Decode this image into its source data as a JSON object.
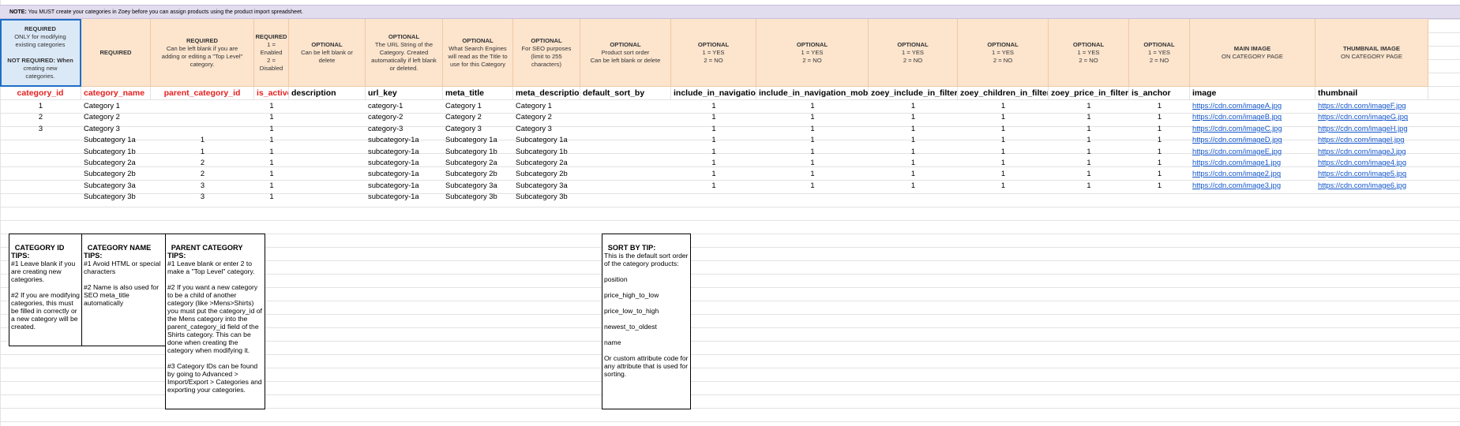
{
  "note": {
    "label": "NOTE:",
    "text": "You MUST create your categories in Zoey before you can assign products using the product import spreadsheet."
  },
  "columns": [
    {
      "key": "category_id",
      "width": 103,
      "name_color": "red",
      "header": [
        "REQUIRED",
        "ONLY for modifying",
        "existing categories",
        "",
        "NOT REQUIRED: When",
        "creating new",
        "categories."
      ],
      "align": "c"
    },
    {
      "key": "category_name",
      "width": 88,
      "name_color": "red",
      "header": [
        "REQUIRED"
      ],
      "align": "l"
    },
    {
      "key": "parent_category_id",
      "width": 131,
      "name_color": "red",
      "header": [
        "REQUIRED",
        "Can be left blank if you are",
        "adding or editing a \"Top Level\"",
        "category."
      ],
      "align": "c"
    },
    {
      "key": "is_active",
      "width": 44,
      "name_color": "red",
      "header": [
        "REQUIRED",
        "1 = Enabled",
        "2 = Disabled"
      ],
      "align": "c"
    },
    {
      "key": "description",
      "width": 97,
      "name_color": "black",
      "header": [
        "OPTIONAL",
        "Can be left blank or",
        "delete"
      ],
      "align": "l"
    },
    {
      "key": "url_key",
      "width": 98,
      "name_color": "black",
      "header": [
        "OPTIONAL",
        "The URL String of the",
        "Category. Created",
        "automatically if left blank",
        "or deleted."
      ],
      "align": "l"
    },
    {
      "key": "meta_title",
      "width": 89,
      "name_color": "black",
      "header": [
        "OPTIONAL",
        "What Search Engines",
        "will read as the Title to",
        "use for this Category"
      ],
      "align": "l"
    },
    {
      "key": "meta_description",
      "width": 85,
      "name_color": "black",
      "header": [
        "OPTIONAL",
        "For SEO purposes",
        "(limit to 255",
        "characters)"
      ],
      "align": "l"
    },
    {
      "key": "default_sort_by",
      "width": 115,
      "name_color": "black",
      "header": [
        "OPTIONAL",
        "Product sort order",
        "Can be left blank or delete"
      ],
      "align": "l"
    },
    {
      "key": "include_in_navigation",
      "width": 108,
      "name_color": "black",
      "header": [
        "OPTIONAL",
        "1 = YES",
        "2 = NO"
      ],
      "align": "c"
    },
    {
      "key": "include_in_navigation_mobile",
      "width": 142,
      "name_color": "black",
      "header": [
        "OPTIONAL",
        "1 = YES",
        "2 = NO"
      ],
      "align": "c"
    },
    {
      "key": "zoey_include_in_filters",
      "width": 113,
      "name_color": "black",
      "header": [
        "OPTIONAL",
        "1 = YES",
        "2 = NO"
      ],
      "align": "c"
    },
    {
      "key": "zoey_children_in_filters",
      "width": 115,
      "name_color": "black",
      "header": [
        "OPTIONAL",
        "1 = YES",
        "2 = NO"
      ],
      "align": "c"
    },
    {
      "key": "zoey_price_in_filters",
      "width": 102,
      "name_color": "black",
      "header": [
        "OPTIONAL",
        "1 = YES",
        "2 = NO"
      ],
      "align": "c"
    },
    {
      "key": "is_anchor",
      "width": 77,
      "name_color": "black",
      "header": [
        "OPTIONAL",
        "1 = YES",
        "2 = NO"
      ],
      "align": "c"
    },
    {
      "key": "image",
      "width": 159,
      "name_color": "black",
      "header": [
        "MAIN IMAGE",
        "ON CATEGORY PAGE"
      ],
      "align": "l"
    },
    {
      "key": "thumbnail",
      "width": 143,
      "name_color": "black",
      "header": [
        "THUMBNAIL IMAGE",
        "ON CATEGORY PAGE"
      ],
      "align": "l"
    }
  ],
  "rows": [
    [
      "1",
      "Category 1",
      "",
      "1",
      "",
      "category-1",
      "Category 1",
      "Category 1",
      "",
      "1",
      "1",
      "1",
      "1",
      "1",
      "1",
      "https://cdn.com/imageA.jpg",
      "https://cdn.com/imageF.jpg"
    ],
    [
      "2",
      "Category 2",
      "",
      "1",
      "",
      "category-2",
      "Category 2",
      "Category 2",
      "",
      "1",
      "1",
      "1",
      "1",
      "1",
      "1",
      "https://cdn.com/imageB.jpg",
      "https://cdn.com/imageG.jpg"
    ],
    [
      "3",
      "Category 3",
      "",
      "1",
      "",
      "category-3",
      "Category 3",
      "Category 3",
      "",
      "1",
      "1",
      "1",
      "1",
      "1",
      "1",
      "https://cdn.com/imageC.jpg",
      "https://cdn.com/imageH.jpg"
    ],
    [
      "",
      "Subcategory 1a",
      "1",
      "1",
      "",
      "subcategory-1a",
      "Subcategory 1a",
      "Subcategory 1a",
      "",
      "1",
      "1",
      "1",
      "1",
      "1",
      "1",
      "https://cdn.com/imageD.jpg",
      "https://cdn.com/imageI.jpg"
    ],
    [
      "",
      "Subcategory 1b",
      "1",
      "1",
      "",
      "subcategory-1a",
      "Subcategory 1b",
      "Subcategory 1b",
      "",
      "1",
      "1",
      "1",
      "1",
      "1",
      "1",
      "https://cdn.com/imageE.jpg",
      "https://cdn.com/imageJ.jpg"
    ],
    [
      "",
      "Subcategory 2a",
      "2",
      "1",
      "",
      "subcategory-1a",
      "Subcategory 2a",
      "Subcategory 2a",
      "",
      "1",
      "1",
      "1",
      "1",
      "1",
      "1",
      "https://cdn.com/image1.jpg",
      "https://cdn.com/image4.jpg"
    ],
    [
      "",
      "Subcategory 2b",
      "2",
      "1",
      "",
      "subcategory-1a",
      "Subcategory 2b",
      "Subcategory 2b",
      "",
      "1",
      "1",
      "1",
      "1",
      "1",
      "1",
      "https://cdn.com/image2.jpg",
      "https://cdn.com/image5.jpg"
    ],
    [
      "",
      "Subcategory 3a",
      "3",
      "1",
      "",
      "subcategory-1a",
      "Subcategory 3a",
      "Subcategory 3a",
      "",
      "1",
      "1",
      "1",
      "1",
      "1",
      "1",
      "https://cdn.com/image3.jpg",
      "https://cdn.com/image6.jpg"
    ],
    [
      "",
      "Subcategory 3b",
      "3",
      "1",
      "",
      "subcategory-1a",
      "Subcategory 3b",
      "Subcategory 3b",
      "",
      "",
      "",
      "",
      "",
      "",
      "",
      "",
      ""
    ]
  ],
  "tips": {
    "category_id": {
      "title": "CATEGORY ID TIPS:",
      "body": "\n#1 Leave blank if you are creating new categories.\n\n#2 If you are modifying categories, this must be filled in correctly or a new category will be created."
    },
    "category_name": {
      "title": "CATEGORY NAME TIPS:",
      "body": "\n#1 Avoid HTML or special characters\n\n#2 Name is also used for SEO meta_title automatically"
    },
    "parent_category": {
      "title": "PARENT CATEGORY TIPS:",
      "body": "\n#1 Leave blank or enter 2 to make a \"Top Level\" category.\n\n#2 If you want a new category to be a child of another category (like >Mens>Shirts) you must put the category_id of the Mens category into the parent_category_id field of the Shirts category. This can be done when creating the category when modifying it.\n\n#3 Category IDs can be found by going to Advanced > Import/Export > Categories and exporting your categories."
    },
    "sort_by": {
      "title": "SORT BY TIP:",
      "body": "\nThis is the default sort order of the category products:\n\nposition\n\nprice_high_to_low\n\nprice_low_to_high\n\nnewest_to_oldest\n\nname\n\nOr custom attribute code for any attribute that is used for sorting."
    }
  },
  "colors": {
    "header_bg": "#fce4cd",
    "note_bg": "#e2dcef",
    "required_name": "#e51f1f",
    "link": "#1155cc",
    "selection": "#1e6fc7"
  }
}
